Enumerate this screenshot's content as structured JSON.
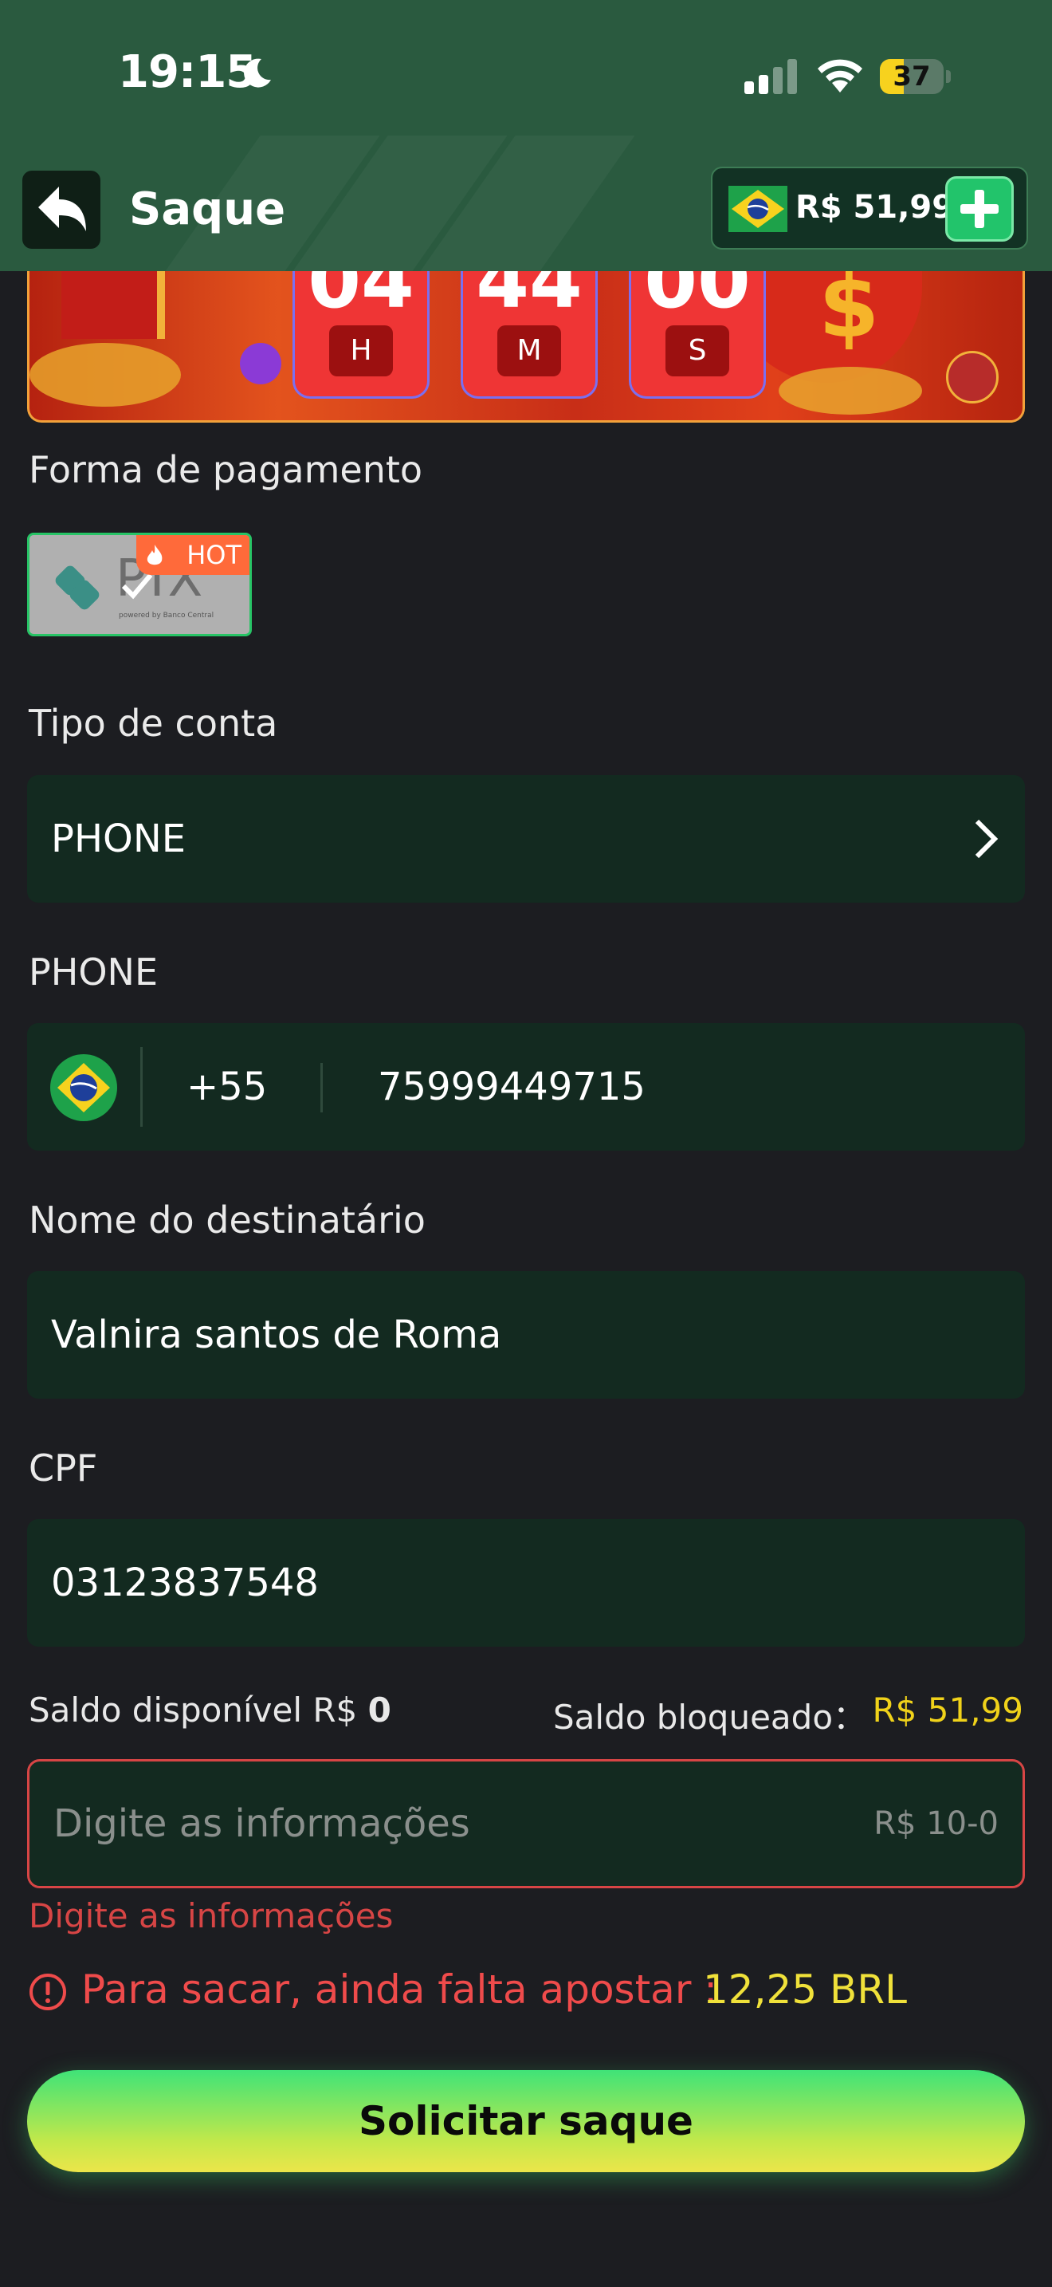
{
  "status_bar": {
    "time": "19:15",
    "battery_level": "37",
    "battery_fraction": 0.37
  },
  "header": {
    "title": "Saque",
    "balance": "R$ 51,99"
  },
  "banner": {
    "countdown": [
      {
        "value": "04",
        "unit": "H"
      },
      {
        "value": "44",
        "unit": "M"
      },
      {
        "value": "00",
        "unit": "S"
      }
    ]
  },
  "payment": {
    "label": "Forma de pagamento",
    "method": "PIX",
    "method_caption": "powered by Banco Central",
    "badge": "HOT"
  },
  "account_type": {
    "label": "Tipo de conta",
    "value": "PHONE"
  },
  "phone": {
    "label": "PHONE",
    "country_code": "+55",
    "number": "75999449715"
  },
  "recipient": {
    "label": "Nome do destinatário",
    "value": "Valnira santos de Roma"
  },
  "cpf": {
    "label": "CPF",
    "value": "03123837548"
  },
  "balances": {
    "available_label": "Saldo disponível R$",
    "available_value": "0",
    "blocked_label": "Saldo bloqueado：",
    "blocked_value": "R$ 51,99"
  },
  "amount": {
    "placeholder": "Digite as informações",
    "range": "R$ 10-0",
    "error": "Digite as informações"
  },
  "warning": {
    "text": "Para sacar, ainda falta apostar :",
    "amount": "12,25 BRL"
  },
  "submit": {
    "label": "Solicitar saque"
  },
  "colors": {
    "accent_green": "#22c46b",
    "error_red": "#d74545",
    "highlight_yellow": "#f0d21a"
  }
}
